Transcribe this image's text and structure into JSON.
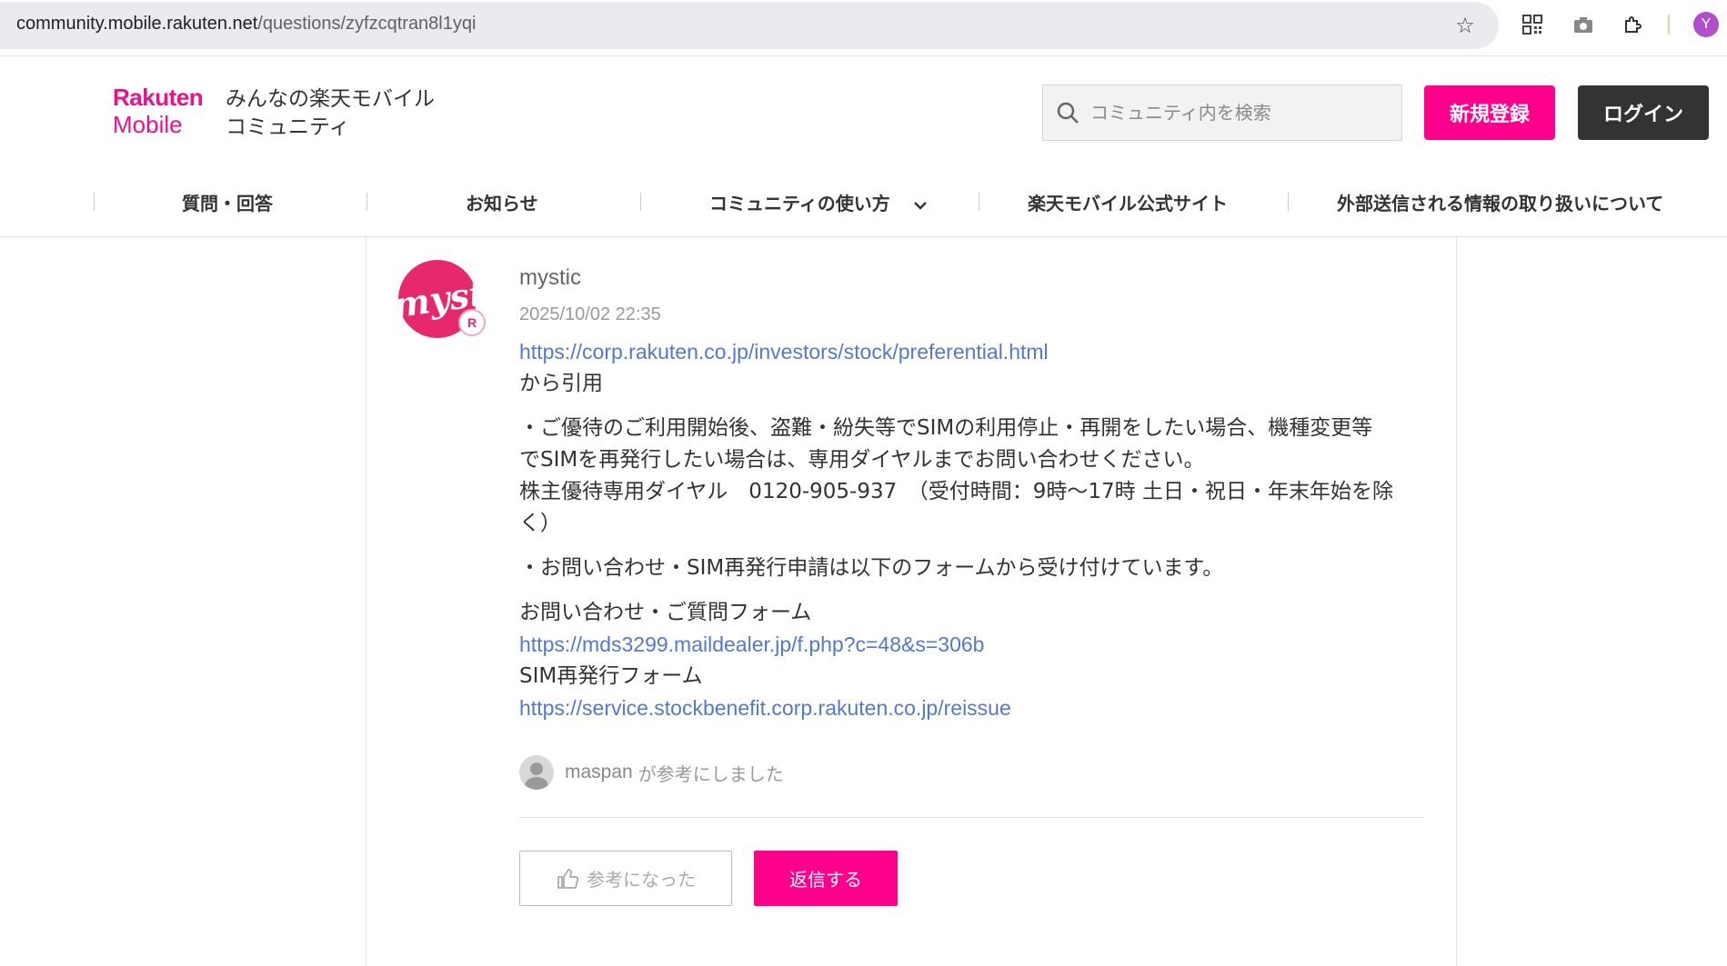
{
  "browser": {
    "url_host": "community.mobile.rakuten.net",
    "url_path": "/questions/zyfzcqtran8l1yqi",
    "profile_initial": "Y",
    "icons": [
      "star-icon",
      "qr-code-icon",
      "camera-icon",
      "extensions-icon"
    ]
  },
  "header": {
    "logo_line1": "Rakuten",
    "logo_line2": "Mobile",
    "site_title_line1": "みんなの楽天モバイル",
    "site_title_line2": "コミュニティ",
    "search_placeholder": "コミュニティ内を検索",
    "register_label": "新規登録",
    "login_label": "ログイン"
  },
  "nav": {
    "items": [
      {
        "label": "質問・回答"
      },
      {
        "label": "お知らせ"
      },
      {
        "label": "コミュニティの使い方"
      },
      {
        "label": "楽天モバイル公式サイト"
      },
      {
        "label": "外部送信される情報の取り扱いについて"
      }
    ]
  },
  "post": {
    "avatar_text": "mystic",
    "badge": "R",
    "author": "mystic",
    "date": "2025/10/02 22:35",
    "link1": "https://corp.rakuten.co.jp/investors/stock/preferential.html",
    "quoted_from": "から引用",
    "para1_line1": "・ご優待のご利用開始後、盗難・紛失等でSIMの利用停止・再開をしたい場合、機種変更等",
    "para1_line2": "でSIMを再発行したい場合は、専用ダイヤルまでお問い合わせください。",
    "para1_line3": "株主優待専用ダイヤル　0120-905-937　（受付時間：9時〜17時 土日・祝日・年末年始を除",
    "para1_line4": "く）",
    "para2": "・お問い合わせ・SIM再発行申請は以下のフォームから受け付けています。",
    "form1_label": "お問い合わせ・ご質問フォーム",
    "form1_link": "https://mds3299.maildealer.jp/f.php?c=48&s=306b",
    "form2_label": "SIM再発行フォーム",
    "form2_link": "https://service.stockbenefit.corp.rakuten.co.jp/reissue",
    "ref_user": "maspan",
    "ref_text": "が参考にしました",
    "helpful_label": "参考になった",
    "reply_label": "返信する"
  },
  "colors": {
    "brand": "#ff008c",
    "link": "#5577cc",
    "dark_button": "#333333"
  }
}
